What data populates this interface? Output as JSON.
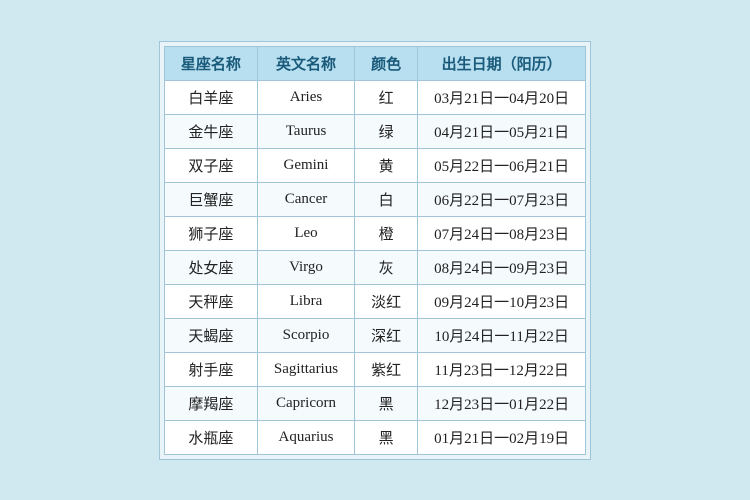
{
  "table": {
    "headers": [
      "星座名称",
      "英文名称",
      "颜色",
      "出生日期（阳历）"
    ],
    "rows": [
      [
        "白羊座",
        "Aries",
        "红",
        "03月21日一04月20日"
      ],
      [
        "金牛座",
        "Taurus",
        "绿",
        "04月21日一05月21日"
      ],
      [
        "双子座",
        "Gemini",
        "黄",
        "05月22日一06月21日"
      ],
      [
        "巨蟹座",
        "Cancer",
        "白",
        "06月22日一07月23日"
      ],
      [
        "狮子座",
        "Leo",
        "橙",
        "07月24日一08月23日"
      ],
      [
        "处女座",
        "Virgo",
        "灰",
        "08月24日一09月23日"
      ],
      [
        "天秤座",
        "Libra",
        "淡红",
        "09月24日一10月23日"
      ],
      [
        "天蝎座",
        "Scorpio",
        "深红",
        "10月24日一11月22日"
      ],
      [
        "射手座",
        "Sagittarius",
        "紫红",
        "11月23日一12月22日"
      ],
      [
        "摩羯座",
        "Capricorn",
        "黑",
        "12月23日一01月22日"
      ],
      [
        "水瓶座",
        "Aquarius",
        "黑",
        "01月21日一02月19日"
      ]
    ]
  }
}
